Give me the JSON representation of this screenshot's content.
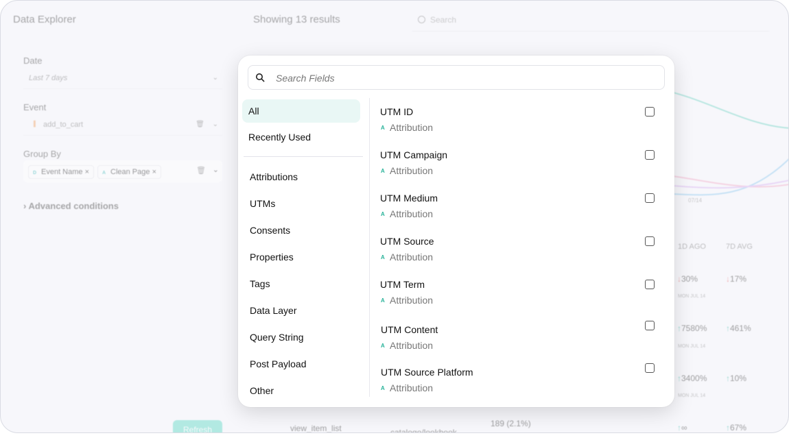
{
  "app": {
    "title": "Data Explorer",
    "results_label": "Showing 13 results",
    "search_placeholder": "Search"
  },
  "filters": {
    "date_label": "Date",
    "date_value": "Last 7 days",
    "event_label": "Event",
    "event_value": "add_to_cart",
    "group_by_label": "Group By",
    "group_by_chips": [
      {
        "badge": "D",
        "label": "Event Name"
      },
      {
        "badge": "A",
        "label": "Clean Page"
      }
    ],
    "advanced_label": "Advanced conditions",
    "refresh_label": "Refresh"
  },
  "background_table": {
    "headers": {
      "ago": "1D AGO",
      "avg": "7D AVG"
    },
    "rows": [
      {
        "ago": "30%",
        "ago_dir": "down",
        "avg": "17%",
        "avg_dir": "down",
        "sub": "MON JUL 14"
      },
      {
        "ago": "7580%",
        "ago_dir": "up",
        "avg": "461%",
        "avg_dir": "up",
        "sub": "MON JUL 14"
      },
      {
        "ago": "3400%",
        "ago_dir": "up",
        "avg": "10%",
        "avg_dir": "up",
        "sub": "MON JUL 14"
      },
      {
        "ago": "∞",
        "ago_dir": "up",
        "avg": "67%",
        "avg_dir": "up",
        "sub": ""
      }
    ],
    "chart_tick": "07/14",
    "last_row": {
      "event": "view_item_list",
      "page": "catalogo/lookbook",
      "value": "189 (2.1%)"
    }
  },
  "modal": {
    "search_placeholder": "Search Fields",
    "categories_top": [
      "All",
      "Recently Used"
    ],
    "categories": [
      "Attributions",
      "UTMs",
      "Consents",
      "Properties",
      "Tags",
      "Data Layer",
      "Query String",
      "Post Payload",
      "Other"
    ],
    "active_category": "All",
    "fields": [
      {
        "name": "UTM ID",
        "badge": "A",
        "group": "Attribution",
        "checked": false
      },
      {
        "name": "UTM Campaign",
        "badge": "A",
        "group": "Attribution",
        "checked": false
      },
      {
        "name": "UTM Medium",
        "badge": "A",
        "group": "Attribution",
        "checked": false
      },
      {
        "name": "UTM Source",
        "badge": "A",
        "group": "Attribution",
        "checked": false
      },
      {
        "name": "UTM Term",
        "badge": "A",
        "group": "Attribution",
        "checked": false
      },
      {
        "name": "UTM Content",
        "badge": "A",
        "group": "Attribution",
        "checked": false
      },
      {
        "name": "UTM Source Platform",
        "badge": "A",
        "group": "Attribution",
        "checked": false
      }
    ]
  },
  "colors": {
    "accent": "#2ab3a0",
    "active_bg": "#e9f7f5",
    "negative": "#e25b5b"
  },
  "icons": {
    "search": "magnifier-icon",
    "badge": "attribution-icon",
    "delete": "trash-icon",
    "chevron": "chevron-down-icon"
  }
}
